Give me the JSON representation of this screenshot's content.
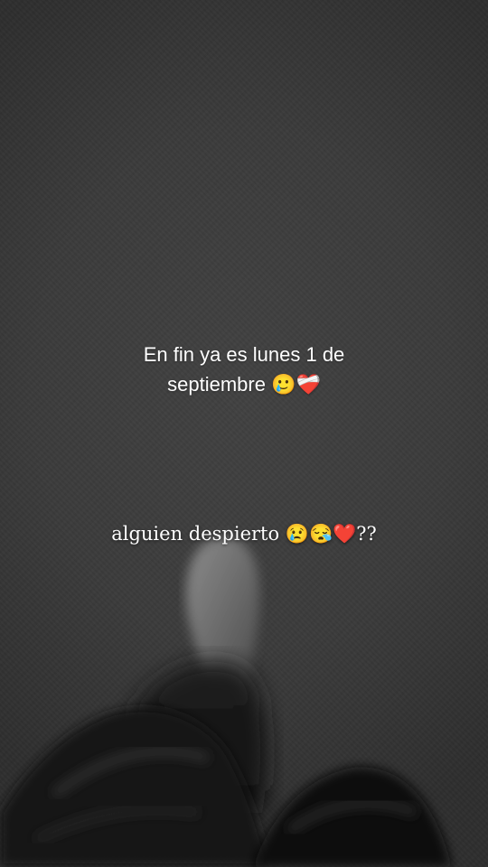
{
  "overlay_text": {
    "line1": "En fin ya es lunes 1 de",
    "line2": "septiembre 🥲❤️‍🩹",
    "line3": "alguien despierto 😢😪❤️??"
  }
}
